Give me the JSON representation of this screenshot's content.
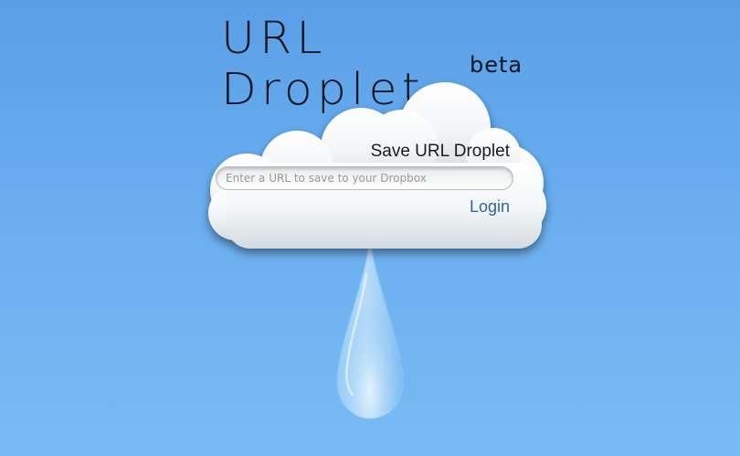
{
  "logo": {
    "main": "URL Droplet",
    "sub": "beta"
  },
  "form": {
    "title": "Save URL Droplet",
    "url_placeholder": "Enter a URL to save to your Dropbox",
    "login_label": "Login"
  }
}
